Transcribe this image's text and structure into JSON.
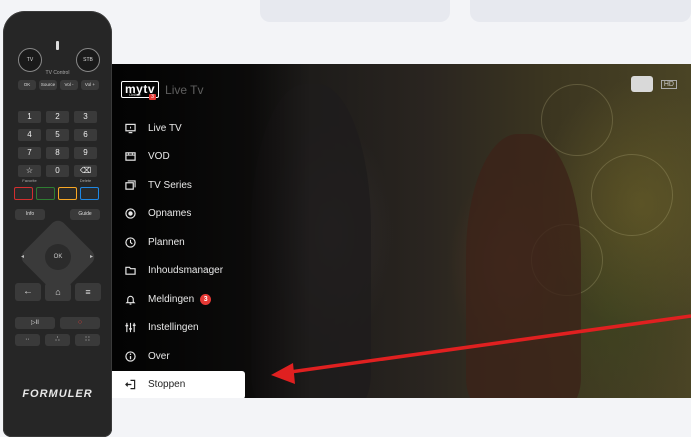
{
  "screen": {
    "logo_text": "mytv",
    "logo_badge": "3",
    "logo_sub": "Online",
    "header_title": "Live Tv",
    "channel_quality": "HD"
  },
  "menu": {
    "items": [
      {
        "label": "Live TV",
        "icon": "tv-icon"
      },
      {
        "label": "VOD",
        "icon": "film-icon"
      },
      {
        "label": "TV Series",
        "icon": "series-icon"
      },
      {
        "label": "Opnames",
        "icon": "record-icon"
      },
      {
        "label": "Plannen",
        "icon": "clock-icon"
      },
      {
        "label": "Inhoudsmanager",
        "icon": "folder-icon"
      },
      {
        "label": "Meldingen",
        "icon": "bell-icon",
        "badge": "3"
      },
      {
        "label": "Instellingen",
        "icon": "settings-sliders-icon"
      },
      {
        "label": "Over",
        "icon": "info-icon"
      },
      {
        "label": "Stoppen",
        "icon": "exit-icon",
        "selected": true
      }
    ]
  },
  "remote": {
    "tv": "TV",
    "stb": "STB",
    "tv_control": "TV Control",
    "tv_row": [
      "OK",
      "Source",
      "Vol -",
      "Vol +"
    ],
    "num_rows": [
      [
        "1",
        "2",
        "3"
      ],
      [
        "4",
        "5",
        "6"
      ],
      [
        "7",
        "8",
        "9"
      ],
      [
        "☆",
        "0",
        "⌫"
      ]
    ],
    "favorite": "Favorite",
    "delete": "Delete",
    "info": "Info",
    "guide": "Guide",
    "ok": "OK",
    "brand": "FORMULER"
  },
  "colors": {
    "accent_red": "#e53935",
    "arrow_red": "#e02020",
    "btn_red": "#d32f2f",
    "btn_green": "#2e7d32",
    "btn_yellow": "#f9a825",
    "btn_blue": "#1e88e5"
  }
}
